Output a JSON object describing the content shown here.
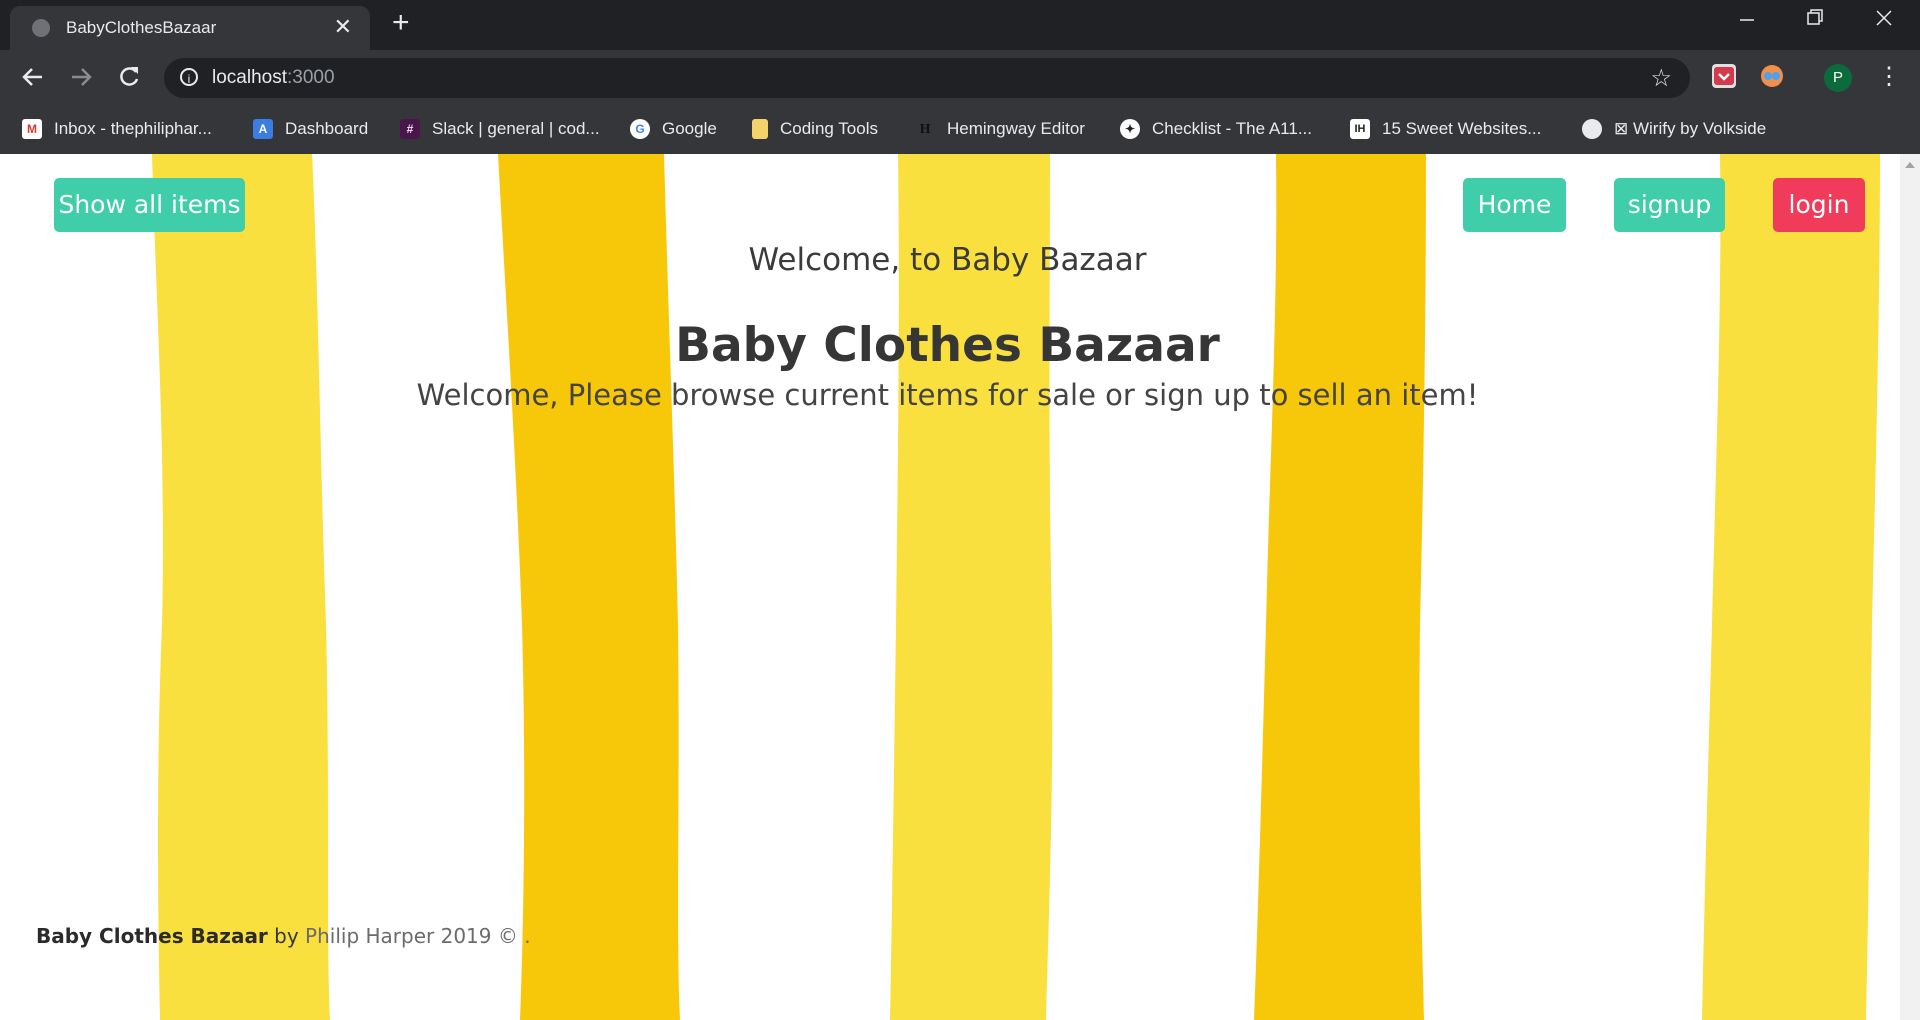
{
  "browser": {
    "tab_title": "BabyClothesBazaar",
    "tab_close": "✕",
    "new_tab": "+",
    "url_host": "localhost",
    "url_port": ":3000",
    "profile_initial": "P",
    "bookmarks": [
      {
        "label": "Inbox - thephiliphar...",
        "icon": "gmail-icon"
      },
      {
        "label": "Dashboard",
        "icon": "dashboard-icon"
      },
      {
        "label": "Slack | general | cod...",
        "icon": "slack-icon"
      },
      {
        "label": "Google",
        "icon": "google-icon"
      },
      {
        "label": "Coding Tools",
        "icon": "folder-icon"
      },
      {
        "label": "Hemingway Editor",
        "icon": "hemingway-icon"
      },
      {
        "label": "Checklist - The A11...",
        "icon": "accessibility-icon"
      },
      {
        "label": "15 Sweet Websites...",
        "icon": "ih-icon"
      },
      {
        "label": "⊠ Wirify by Volkside",
        "icon": "globe-icon"
      }
    ]
  },
  "nav": {
    "show_all": "Show all items",
    "home": "Home",
    "signup": "signup",
    "login": "login"
  },
  "hero": {
    "greeting": "Welcome, to Baby Bazaar",
    "title": "Baby Clothes Bazaar",
    "subtitle": "Welcome, Please browse current items for sale or sign up to sell an item!"
  },
  "footer": {
    "brand": "Baby Clothes Bazaar",
    "by": " by ",
    "author": "Philip Harper 2019 © ."
  },
  "colors": {
    "teal_button": "#3fcdaa",
    "login_button": "#f03b5a",
    "stripe_light": "#f9e03f",
    "stripe_dark": "#f7c80a"
  }
}
